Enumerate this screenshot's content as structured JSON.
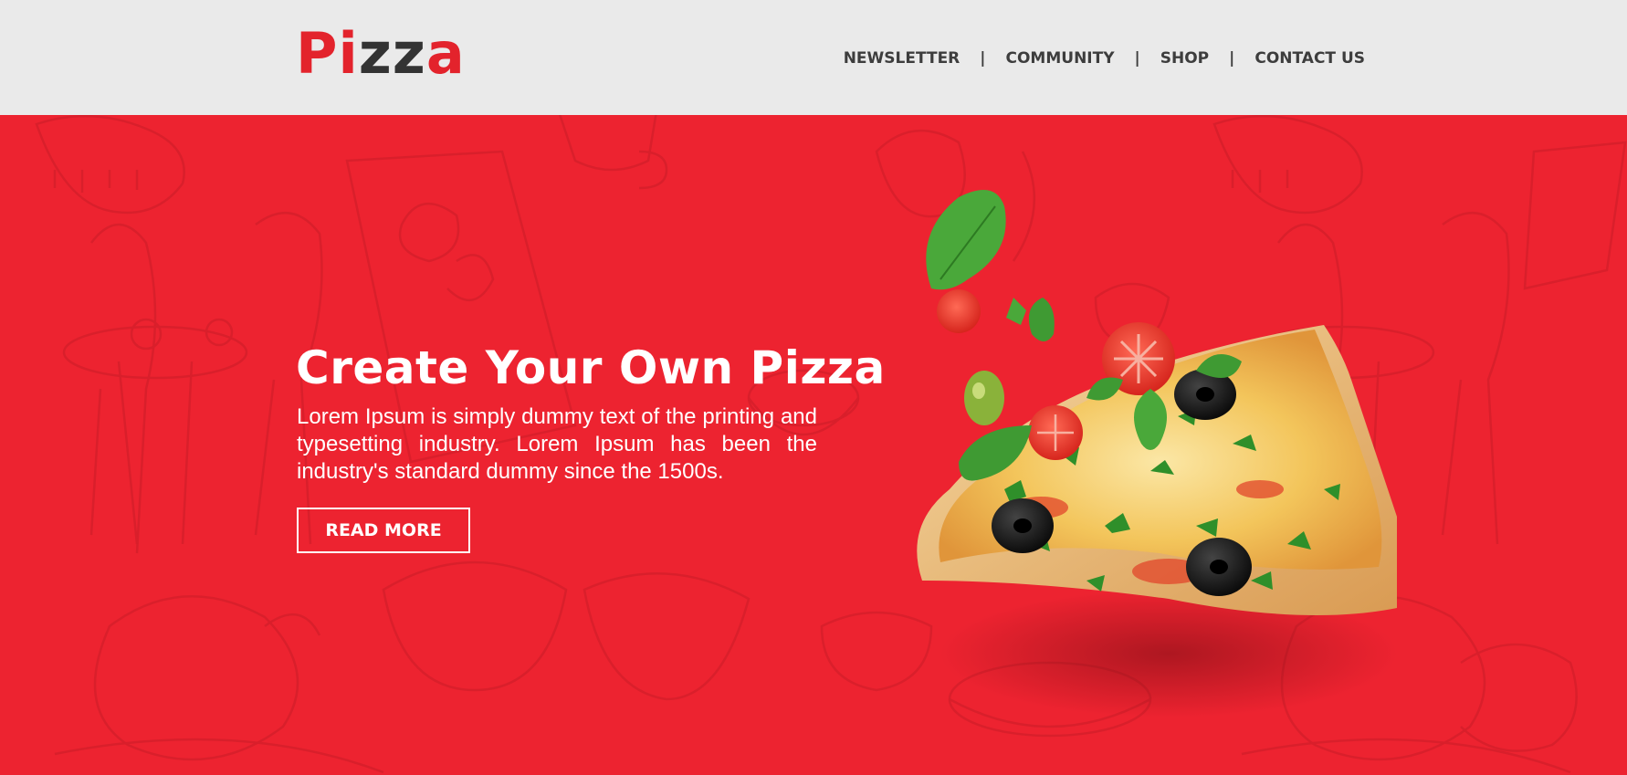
{
  "brand": {
    "logo_part1": "Pi",
    "logo_part2": "zz",
    "logo_part3": "a"
  },
  "nav": {
    "items": [
      {
        "label": "NEWSLETTER"
      },
      {
        "label": "COMMUNITY"
      },
      {
        "label": "SHOP"
      },
      {
        "label": "CONTACT US"
      }
    ],
    "separator": "|"
  },
  "hero": {
    "title": "Create Your Own Pizza",
    "description": "Lorem Ipsum is simply dummy text of the printing and typesetting industry. Lorem Ipsum has been the industry's standard dummy since the 1500s.",
    "button_label": "READ MORE",
    "image": "pizza-slice-with-flying-toppings"
  },
  "colors": {
    "brand_red": "#ed2330",
    "header_bg": "#eaeaea",
    "nav_text": "#3d3d3d",
    "logo_dark": "#333333"
  }
}
